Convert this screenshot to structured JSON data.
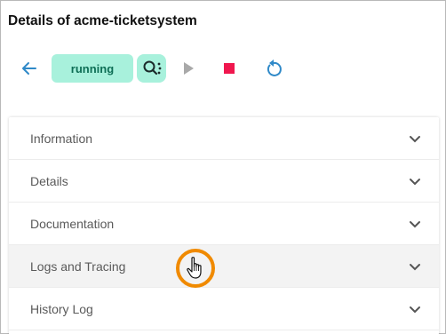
{
  "page": {
    "title": "Details of acme-ticketsystem"
  },
  "toolbar": {
    "back_icon": "arrow-left-icon",
    "status_label": "running",
    "search_icon": "search-log-icon",
    "play_icon": "play-icon",
    "stop_icon": "stop-icon",
    "refresh_icon": "refresh-icon"
  },
  "sections": [
    {
      "label": "Information"
    },
    {
      "label": "Details"
    },
    {
      "label": "Documentation"
    },
    {
      "label": "Logs and Tracing"
    },
    {
      "label": "History Log"
    }
  ],
  "colors": {
    "accent_blue": "#2f89c8",
    "status_bg": "#a8f1dc",
    "status_text": "#0d6e55",
    "stop_red": "#f0174e",
    "play_disabled": "#a9a9a9",
    "cursor_ring": "#f08a00"
  }
}
